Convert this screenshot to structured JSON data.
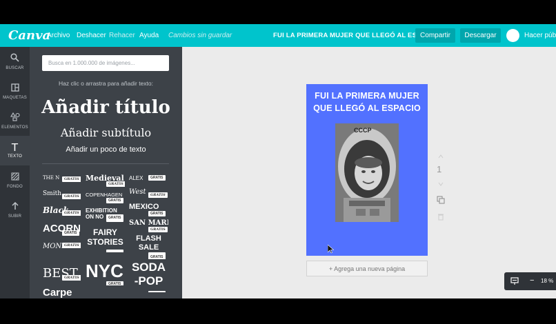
{
  "app": {
    "logo": "Canva"
  },
  "menu": {
    "archivo": "Archivo",
    "deshacer": "Deshacer",
    "rehacer": "Rehacer",
    "ayuda": "Ayuda",
    "status": "Cambios sin guardar"
  },
  "document": {
    "title": "FUI LA PRIMERA MUJER QUE LLEGÓ AL ESPACIO"
  },
  "actions": {
    "share": "Compartir",
    "download": "Descargar",
    "account": "Hacer públi"
  },
  "rail": [
    {
      "label": "BUSCAR",
      "icon": "search-icon"
    },
    {
      "label": "MAQUETAS",
      "icon": "layout-icon"
    },
    {
      "label": "ELEMENTOS",
      "icon": "shapes-icon"
    },
    {
      "label": "TEXTO",
      "icon": "text-icon"
    },
    {
      "label": "FONDO",
      "icon": "background-icon"
    },
    {
      "label": "SUBIR",
      "icon": "upload-icon"
    }
  ],
  "panel": {
    "search_placeholder": "Busca en 1.000.000 de imágenes...",
    "hint": "Haz clic o arrastra para añadir texto:",
    "add_title": "Añadir título",
    "add_subtitle": "Añadir subtítulo",
    "add_body": "Añadir un poco de texto",
    "badge": "GRATIS",
    "templates": [
      {
        "text": "THE N"
      },
      {
        "text": "Medieval"
      },
      {
        "text": "ALEX"
      },
      {
        "text": "Smith"
      },
      {
        "text": "COPENHAGEN"
      },
      {
        "text": "West"
      },
      {
        "text": "Black"
      },
      {
        "text": "EXHIBITION ON NO"
      },
      {
        "text": "MEXICO"
      },
      {
        "text": "ACORN"
      },
      {
        "text": "FAIRY STORIES"
      },
      {
        "text": "SAN MARINO"
      },
      {
        "text": "MONDAY"
      },
      {
        "text": "FLASH SALE"
      },
      {
        "text": "BEST"
      },
      {
        "text": "NYC"
      },
      {
        "text": "SODA -POP"
      },
      {
        "text": "Carpe"
      }
    ]
  },
  "canvas": {
    "page_title_line1": "FUI LA PRIMERA MUJER",
    "page_title_line2": "QUE LLEGÓ AL ESPACIO",
    "helmet_text": "CCCP",
    "add_page": "+ Agrega una nueva página",
    "page_number": "1"
  },
  "zoom": {
    "value": "18 %",
    "minus": "−"
  },
  "colors": {
    "header": "#00c4cc",
    "page": "#5271ff",
    "panel": "#3d4248",
    "rail": "#2f3338"
  }
}
